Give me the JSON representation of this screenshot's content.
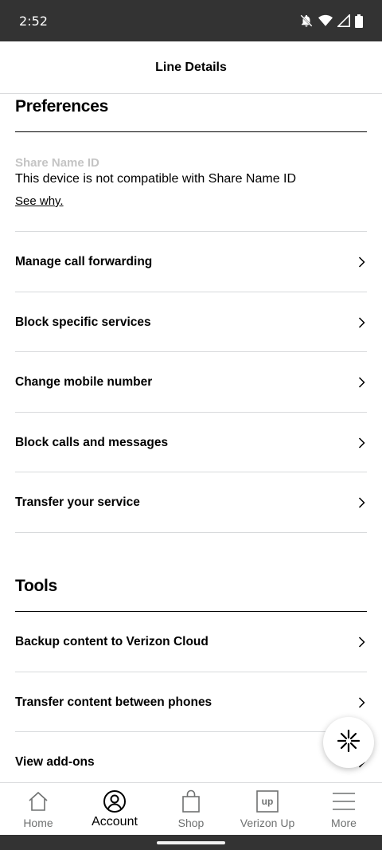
{
  "status_bar": {
    "time": "2:52",
    "icons": [
      "bell-off-icon",
      "wifi-icon",
      "signal-icon",
      "battery-icon"
    ]
  },
  "header": {
    "title": "Line Details"
  },
  "preferences": {
    "title": "Preferences",
    "share_name": {
      "label": "Share Name ID",
      "text": "This device is not compatible with Share Name ID",
      "link": "See why."
    },
    "items": [
      {
        "label": "Manage call forwarding"
      },
      {
        "label": "Block specific services"
      },
      {
        "label": "Change mobile number"
      },
      {
        "label": "Block calls and messages"
      },
      {
        "label": "Transfer your service"
      }
    ]
  },
  "tools": {
    "title": "Tools",
    "items": [
      {
        "label": "Backup content to Verizon Cloud"
      },
      {
        "label": "Transfer content between phones"
      },
      {
        "label": "View add-ons"
      }
    ]
  },
  "fab": {
    "icon": "sparkle-assistant-icon"
  },
  "bottom_nav": {
    "items": [
      {
        "label": "Home",
        "icon": "home-icon",
        "active": false
      },
      {
        "label": "Account",
        "icon": "account-icon",
        "active": true
      },
      {
        "label": "Shop",
        "icon": "shopping-bag-icon",
        "active": false
      },
      {
        "label": "Verizon Up",
        "icon": "verizon-up-icon",
        "active": false
      },
      {
        "label": "More",
        "icon": "menu-icon",
        "active": false
      }
    ]
  },
  "colors": {
    "status_bar": "#333333",
    "divider": "#d8dadc",
    "muted_label": "#c4c4c4",
    "nav_inactive": "#6f7171"
  }
}
